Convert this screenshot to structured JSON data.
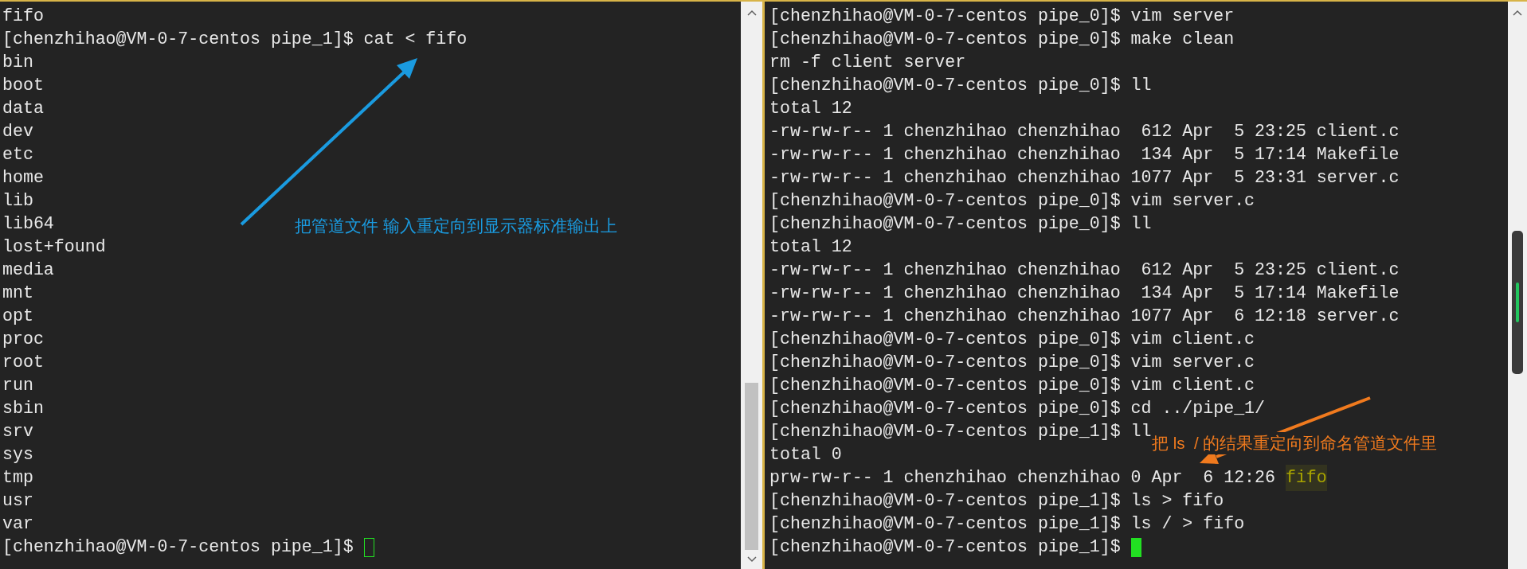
{
  "panes": [
    {
      "focused": false,
      "lines": [
        {
          "text": "fifo"
        },
        {
          "text": "[chenzhihao@VM-0-7-centos pipe_1]$ cat < fifo"
        },
        {
          "text": "bin"
        },
        {
          "text": "boot"
        },
        {
          "text": "data"
        },
        {
          "text": "dev"
        },
        {
          "text": "etc"
        },
        {
          "text": "home"
        },
        {
          "text": "lib"
        },
        {
          "text": "lib64"
        },
        {
          "text": "lost+found"
        },
        {
          "text": "media"
        },
        {
          "text": "mnt"
        },
        {
          "text": "opt"
        },
        {
          "text": "proc"
        },
        {
          "text": "root"
        },
        {
          "text": "run"
        },
        {
          "text": "sbin"
        },
        {
          "text": "srv"
        },
        {
          "text": "sys"
        },
        {
          "text": "tmp"
        },
        {
          "text": "usr"
        },
        {
          "text": "var"
        },
        {
          "text": "[chenzhihao@VM-0-7-centos pipe_1]$ "
        }
      ]
    },
    {
      "focused": true,
      "lines": [
        {
          "text": "[chenzhihao@VM-0-7-centos pipe_0]$ vim server"
        },
        {
          "text": "[chenzhihao@VM-0-7-centos pipe_0]$ make clean"
        },
        {
          "text": "rm -f client server"
        },
        {
          "text": "[chenzhihao@VM-0-7-centos pipe_0]$ ll"
        },
        {
          "text": "total 12"
        },
        {
          "text": "-rw-rw-r-- 1 chenzhihao chenzhihao  612 Apr  5 23:25 client.c"
        },
        {
          "text": "-rw-rw-r-- 1 chenzhihao chenzhihao  134 Apr  5 17:14 Makefile"
        },
        {
          "text": "-rw-rw-r-- 1 chenzhihao chenzhihao 1077 Apr  5 23:31 server.c"
        },
        {
          "text": "[chenzhihao@VM-0-7-centos pipe_0]$ vim server.c"
        },
        {
          "text": "[chenzhihao@VM-0-7-centos pipe_0]$ ll"
        },
        {
          "text": "total 12"
        },
        {
          "text": "-rw-rw-r-- 1 chenzhihao chenzhihao  612 Apr  5 23:25 client.c"
        },
        {
          "text": "-rw-rw-r-- 1 chenzhihao chenzhihao  134 Apr  5 17:14 Makefile"
        },
        {
          "text": "-rw-rw-r-- 1 chenzhihao chenzhihao 1077 Apr  6 12:18 server.c"
        },
        {
          "text": "[chenzhihao@VM-0-7-centos pipe_0]$ vim client.c"
        },
        {
          "text": "[chenzhihao@VM-0-7-centos pipe_0]$ vim server.c"
        },
        {
          "text": "[chenzhihao@VM-0-7-centos pipe_0]$ vim client.c"
        },
        {
          "text": "[chenzhihao@VM-0-7-centos pipe_0]$ cd ../pipe_1/"
        },
        {
          "text": "[chenzhihao@VM-0-7-centos pipe_1]$ ll"
        },
        {
          "text": "total 0"
        },
        {
          "text": "prw-rw-r-- 1 chenzhihao chenzhihao 0 Apr  6 12:26 ",
          "pipe_file": "fifo"
        },
        {
          "text": "[chenzhihao@VM-0-7-centos pipe_1]$ ls > fifo"
        },
        {
          "text": "[chenzhihao@VM-0-7-centos pipe_1]$ ls / > fifo"
        },
        {
          "text": "[chenzhihao@VM-0-7-centos pipe_1]$ "
        }
      ]
    }
  ],
  "annotations": [
    {
      "text": "把管道文件 输入重定向到显示器标准输出上",
      "color": "#1a9be0"
    },
    {
      "text": "把 ls  / 的结果重定向到命名管道文件里",
      "color": "#f07a1e"
    }
  ]
}
